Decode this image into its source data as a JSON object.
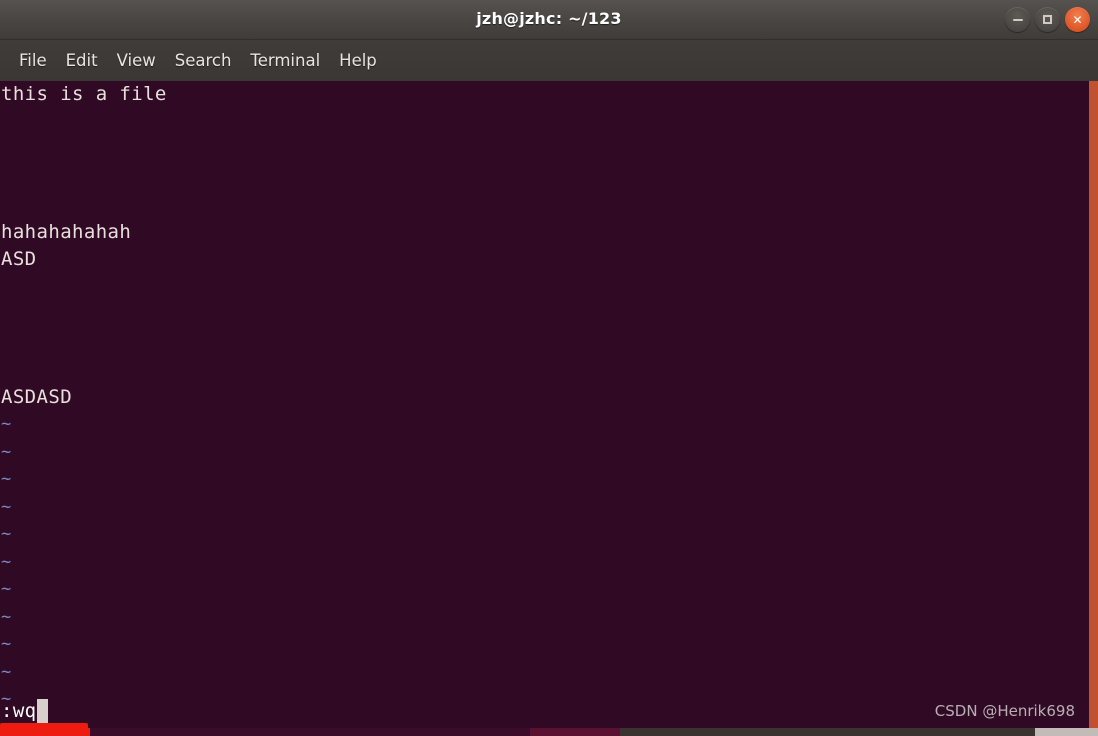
{
  "window": {
    "title": "jzh@jzhc: ~/123",
    "controls": [
      {
        "name": "minimize",
        "label": "—"
      },
      {
        "name": "maximize",
        "label": "☐"
      },
      {
        "name": "close",
        "label": "✕"
      }
    ]
  },
  "menubar": {
    "items": [
      {
        "label": "File"
      },
      {
        "label": "Edit"
      },
      {
        "label": "View"
      },
      {
        "label": "Search"
      },
      {
        "label": "Terminal"
      },
      {
        "label": "Help"
      }
    ]
  },
  "terminal": {
    "background_color": "#300a24",
    "foreground_color": "#e8e0dc",
    "tilde_color": "#7a86c6",
    "border_color": "#c0522f",
    "buffer_lines": [
      "this is a file",
      "",
      "",
      "",
      "",
      "hahahahahah",
      "ASD",
      "",
      "",
      "",
      "",
      "ASDASD"
    ],
    "empty_markers": [
      "~",
      "~",
      "~",
      "~",
      "~",
      "~",
      "~",
      "~",
      "~",
      "~",
      "~"
    ],
    "command_line": ":wq",
    "cursor_char": " ",
    "highlight_color": "#ee1c10"
  },
  "watermark": {
    "text": "CSDN @Henrik698"
  }
}
